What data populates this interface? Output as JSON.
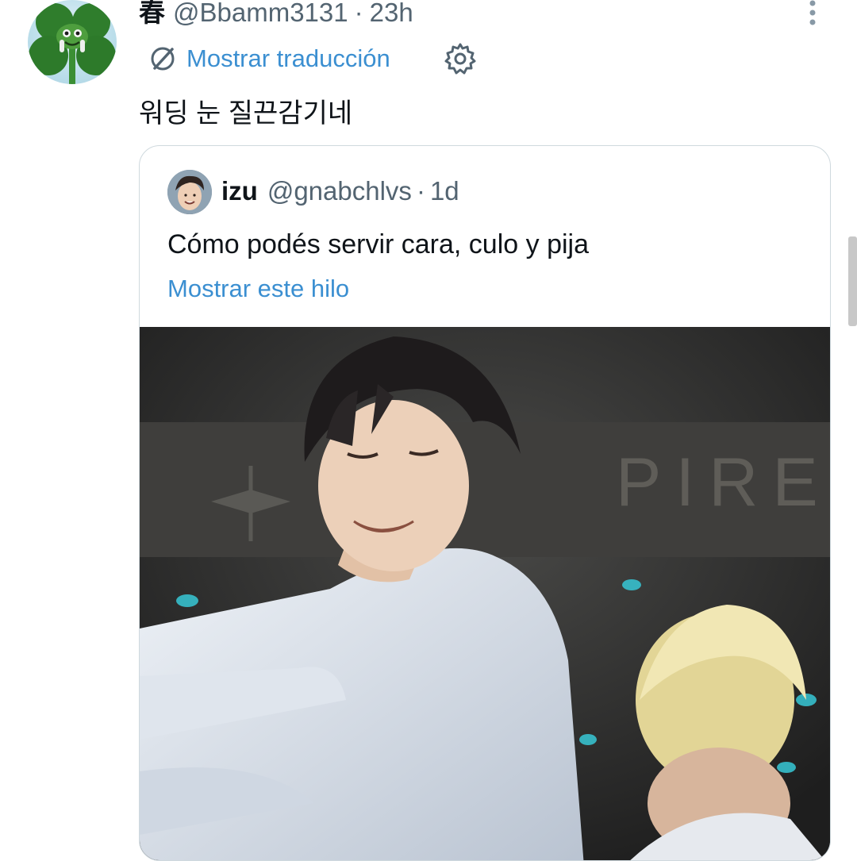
{
  "tweet": {
    "display_name": "春",
    "handle": "@Bbamm3131",
    "separator": "·",
    "time": "23h",
    "translate_label": "Mostrar traducción",
    "text": "워딩 눈 질끈감기네"
  },
  "quote": {
    "display_name": "izu",
    "handle": "@gnabchlvs",
    "separator": "·",
    "time": "1d",
    "text": "Cómo podés servir cara, culo y pija",
    "thread_link": "Mostrar este hilo",
    "media_overlay_text": "PIRE"
  },
  "icons": {
    "more": "more-vertical-icon",
    "translate": "translate-globe-icon",
    "settings": "gear-icon"
  },
  "colors": {
    "link": "#3b8fd1",
    "text": "#0f1419",
    "secondary": "#536471",
    "border": "#cfd9de"
  }
}
